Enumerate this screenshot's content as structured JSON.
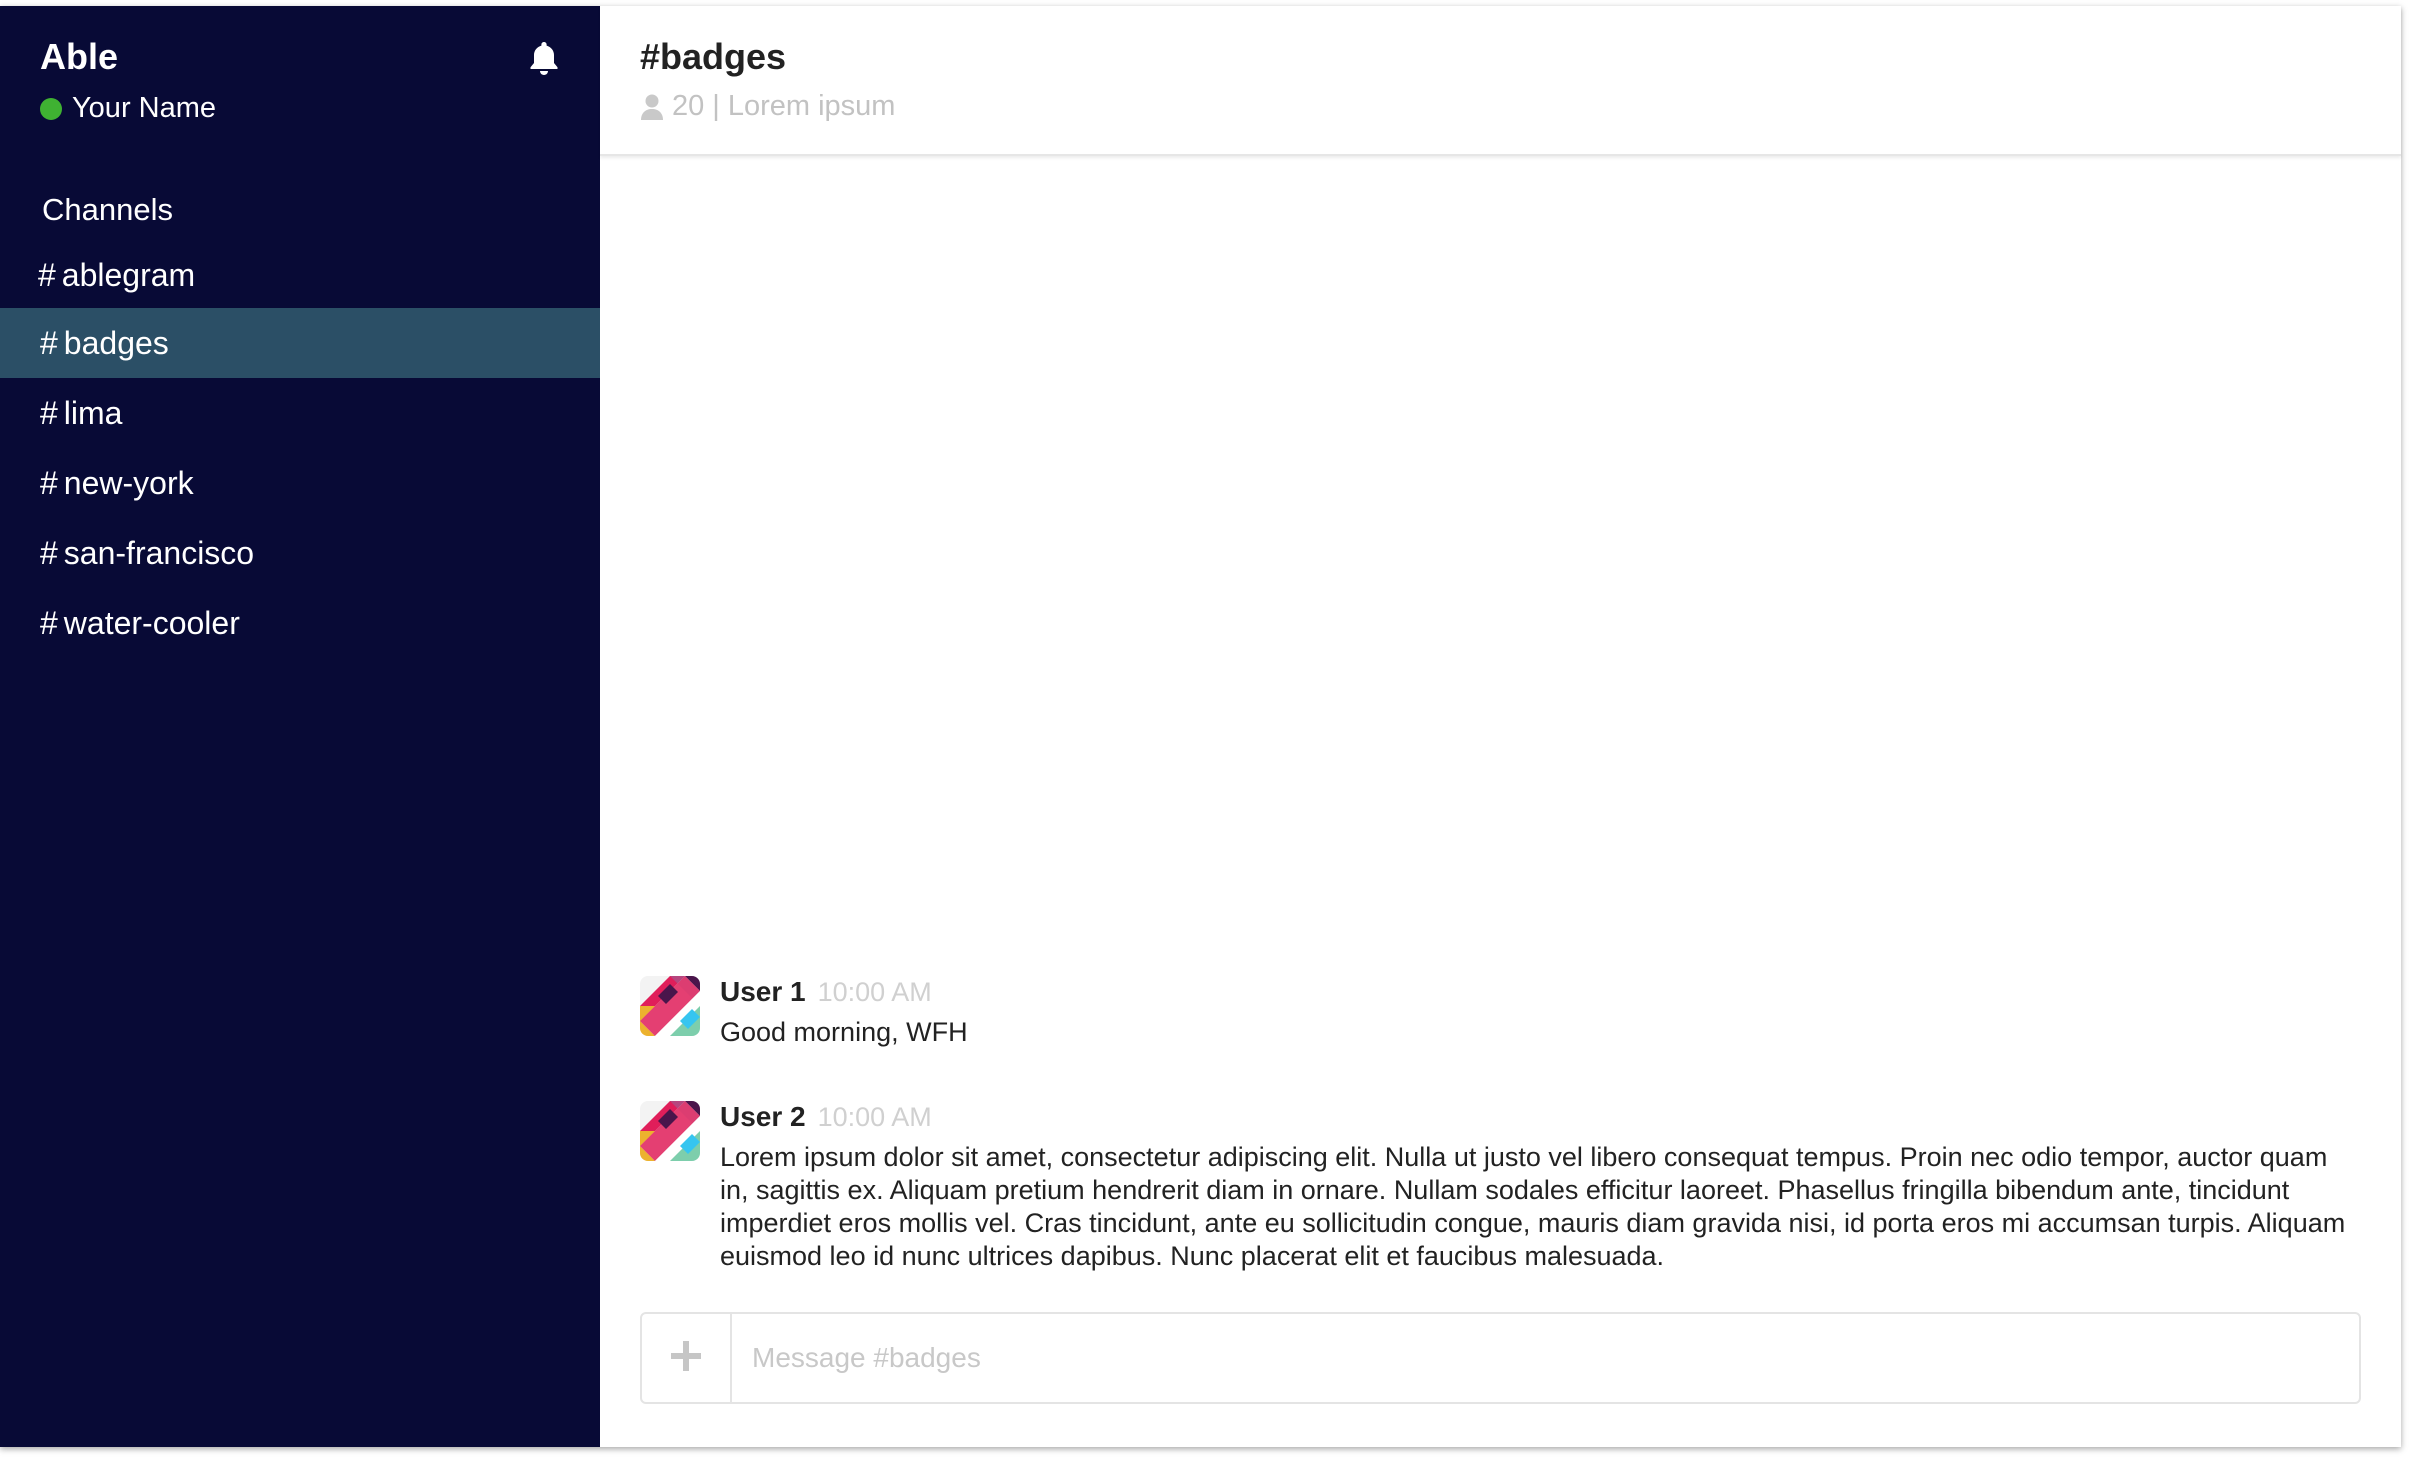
{
  "sidebar": {
    "team_name": "Able",
    "user_name": "Your Name",
    "status_color": "#3fb232",
    "channels_heading": "Channels",
    "channels": [
      {
        "hash": "#",
        "label": "ablegram"
      },
      {
        "hash": "#",
        "label": "badges"
      },
      {
        "hash": "#",
        "label": "lima"
      },
      {
        "hash": "#",
        "label": "new-york"
      },
      {
        "hash": "#",
        "label": "san-francisco"
      },
      {
        "hash": "#",
        "label": "water-cooler"
      }
    ],
    "active_channel": "badges",
    "icons": {
      "notifications": "bell-icon"
    }
  },
  "header": {
    "title": "#badges",
    "member_count": "20",
    "separator": "|",
    "topic": "Lorem ipsum",
    "icons": {
      "members": "user-icon"
    }
  },
  "messages": [
    {
      "user": "User 1",
      "time": "10:00 AM",
      "text": "Good morning, WFH"
    },
    {
      "user": "User 2",
      "time": "10:00 AM",
      "text": "Lorem ipsum dolor sit amet, consectetur adipiscing elit. Nulla ut justo vel libero consequat tempus. Proin nec odio tempor, auctor quam in, sagittis ex. Aliquam pretium hendrerit diam in ornare. Nullam sodales efficitur laoreet. Phasellus fringilla bibendum ante, tincidunt imperdiet eros mollis vel. Cras tincidunt, ante eu sollicitudin congue, mauris diam gravida nisi, id porta eros mi accumsan turpis. Aliquam euismod leo id nunc ultrices dapibus. Nunc placerat elit et faucibus malesuada."
    }
  ],
  "composer": {
    "placeholder": "Message #badges",
    "icons": {
      "add": "plus-icon"
    }
  },
  "colors": {
    "sidebar_bg": "#080a36",
    "active_channel_bg": "#2b4f66"
  }
}
